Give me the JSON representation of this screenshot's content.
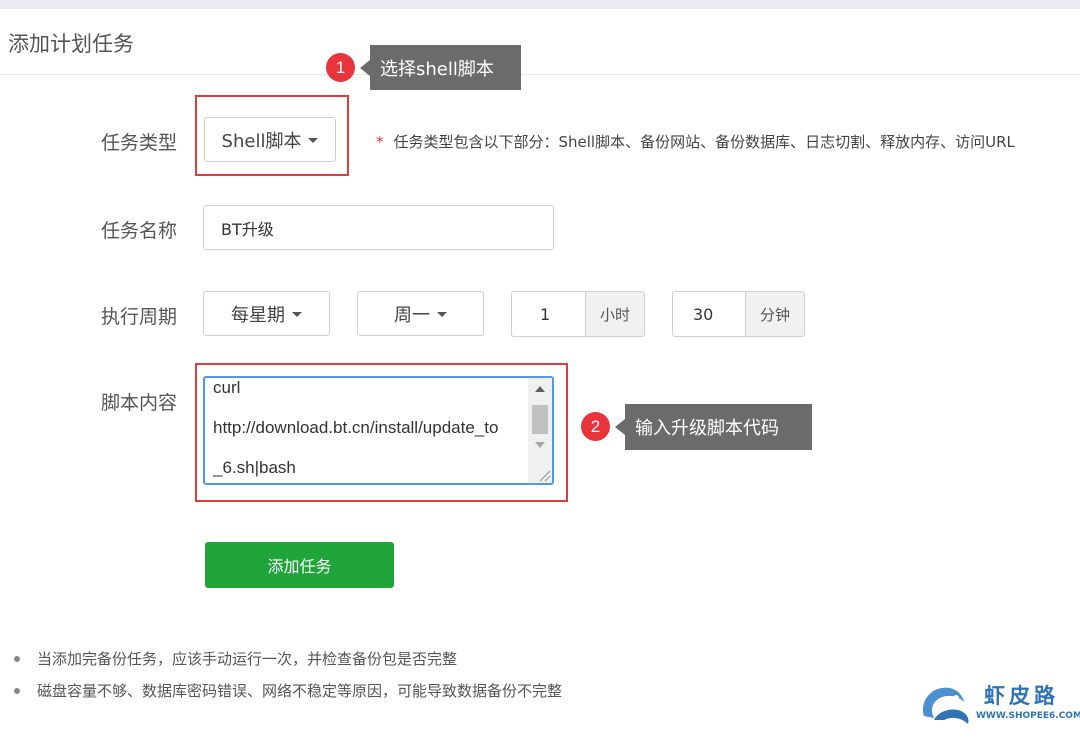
{
  "panel": {
    "title": "添加计划任务"
  },
  "form": {
    "task_type": {
      "label": "任务类型",
      "selected": "Shell脚本",
      "hint_star": "*",
      "hint": "任务类型包含以下部分：Shell脚本、备份网站、备份数据库、日志切割、释放内存、访问URL"
    },
    "task_name": {
      "label": "任务名称",
      "value": "BT升级"
    },
    "schedule": {
      "label": "执行周期",
      "period": "每星期",
      "weekday": "周一",
      "hour": {
        "value": "1",
        "unit": "小时"
      },
      "minute": {
        "value": "30",
        "unit": "分钟"
      }
    },
    "script": {
      "label": "脚本内容",
      "lines": [
        "curl",
        "http://download.bt.cn/install/update_to",
        "_6.sh|bash"
      ]
    },
    "submit_label": "添加任务"
  },
  "annotations": [
    {
      "number": "1",
      "text": "选择shell脚本"
    },
    {
      "number": "2",
      "text": "输入升级脚本代码"
    }
  ],
  "notes": [
    "当添加完备份任务，应该手动运行一次，并检查备份包是否完整",
    "磁盘容量不够、数据库密码错误、网络不稳定等原因，可能导致数据备份不完整"
  ],
  "watermark": {
    "name": "虾皮路",
    "url": "WWW.SHOPEE6.COM"
  },
  "colors": {
    "accent_green": "#20a53a",
    "annotation_red": "#e03c3c",
    "callout_gray": "#6b6b6b",
    "focus_blue": "#4d9be3"
  }
}
